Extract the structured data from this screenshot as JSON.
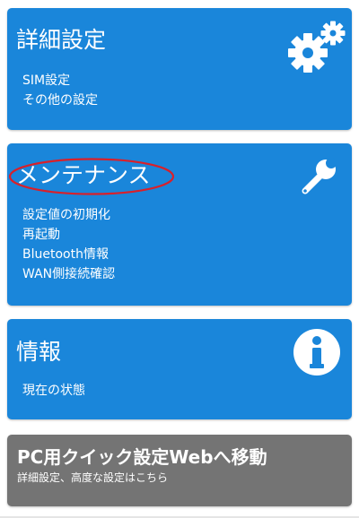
{
  "cards": {
    "advanced": {
      "title": "詳細設定",
      "items": [
        "SIM設定",
        "その他の設定"
      ],
      "icon": "gears-icon"
    },
    "maintenance": {
      "title": "メンテナンス",
      "items": [
        "設定値の初期化",
        "再起動",
        "Bluetooth情報",
        "WAN側接続確認"
      ],
      "icon": "wrench-icon"
    },
    "info": {
      "title": "情報",
      "items": [
        "現在の状態"
      ],
      "icon": "info-icon"
    },
    "web": {
      "title": "PC用クイック設定Webへ移動",
      "subtitle": "詳細設定、高度な設定はこちら"
    }
  },
  "colors": {
    "card_blue": "#1a86da",
    "card_gray": "#747474",
    "annotation_red": "#d9202a"
  }
}
